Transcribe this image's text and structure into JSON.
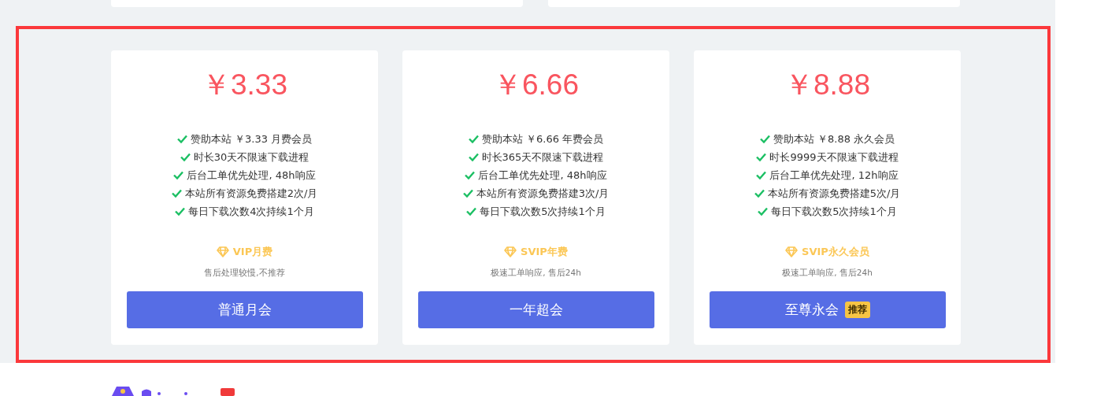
{
  "plans": [
    {
      "price": "￥3.33",
      "features": [
        "赞助本站 ￥3.33 月费会员",
        "时长30天不限速下载进程",
        "后台工单优先处理, 48h响应",
        "本站所有资源免费搭建2次/月",
        "每日下载次数4次持续1个月"
      ],
      "tier": "VIP月费",
      "note": "售后处理较慢,不推荐",
      "button": "普通月会"
    },
    {
      "price": "￥6.66",
      "features": [
        "赞助本站 ￥6.66 年费会员",
        "时长365天不限速下载进程",
        "后台工单优先处理, 48h响应",
        "本站所有资源免费搭建3次/月",
        "每日下载次数5次持续1个月"
      ],
      "tier": "SVIP年费",
      "note": "极速工单响应, 售后24h",
      "button": "一年超会"
    },
    {
      "price": "￥8.88",
      "features": [
        "赞助本站 ￥8.88 永久会员",
        "时长9999天不限速下载进程",
        "后台工单优先处理, 12h响应",
        "本站所有资源免费搭建5次/月",
        "每日下载次数5次持续1个月"
      ],
      "tier": "SVIP永久会员",
      "note": "极速工单响应, 售后24h",
      "button": "至尊永会",
      "badge": "推荐"
    }
  ]
}
